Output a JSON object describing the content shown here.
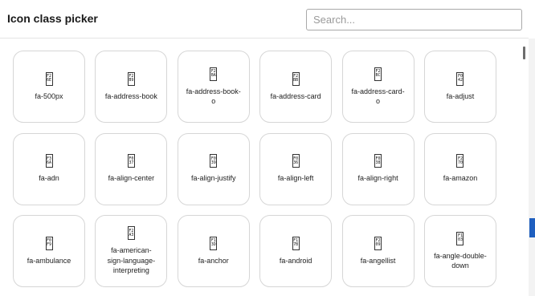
{
  "dialog": {
    "title": "Icon class picker",
    "search": {
      "placeholder": "Search...",
      "value": ""
    }
  },
  "icons": [
    {
      "code_top": "F2",
      "code_bottom": "6E",
      "label": "fa-500px"
    },
    {
      "code_top": "F2",
      "code_bottom": "B9",
      "label": "fa-address-book"
    },
    {
      "code_top": "F2",
      "code_bottom": "BA",
      "label": "fa-address-book-o"
    },
    {
      "code_top": "F2",
      "code_bottom": "BB",
      "label": "fa-address-card"
    },
    {
      "code_top": "F2",
      "code_bottom": "BC",
      "label": "fa-address-card-o"
    },
    {
      "code_top": "F0",
      "code_bottom": "42",
      "label": "fa-adjust"
    },
    {
      "code_top": "F3",
      "code_bottom": "6A",
      "label": "fa-adn"
    },
    {
      "code_top": "F0",
      "code_bottom": "37",
      "label": "fa-align-center"
    },
    {
      "code_top": "F0",
      "code_bottom": "39",
      "label": "fa-align-justify"
    },
    {
      "code_top": "F0",
      "code_bottom": "36",
      "label": "fa-align-left"
    },
    {
      "code_top": "F0",
      "code_bottom": "38",
      "label": "fa-align-right"
    },
    {
      "code_top": "F2",
      "code_bottom": "70",
      "label": "fa-amazon"
    },
    {
      "code_top": "F0",
      "code_bottom": "F9",
      "label": "fa-ambulance"
    },
    {
      "code_top": "F2",
      "code_bottom": "A3",
      "label": "fa-american-sign-language-interpreting"
    },
    {
      "code_top": "F1",
      "code_bottom": "3D",
      "label": "fa-anchor"
    },
    {
      "code_top": "F1",
      "code_bottom": "7B",
      "label": "fa-android"
    },
    {
      "code_top": "F2",
      "code_bottom": "09",
      "label": "fa-angellist"
    },
    {
      "code_top": "F1",
      "code_bottom": "03",
      "label": "fa-angle-double-down"
    }
  ]
}
